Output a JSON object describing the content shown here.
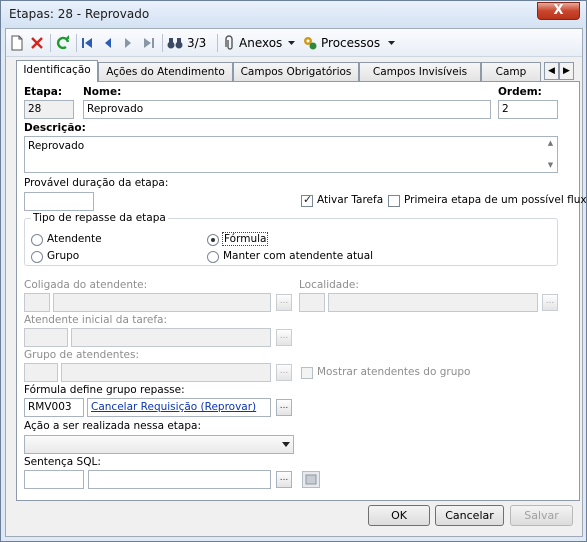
{
  "window": {
    "title": "Etapas: 28 - Reprovado",
    "close_label": "X"
  },
  "toolbar": {
    "record_counter": "3/3",
    "attachments_label": "Anexos",
    "processes_label": "Processos"
  },
  "tabs": [
    {
      "label": "Identificação"
    },
    {
      "label": "Ações do Atendimento"
    },
    {
      "label": "Campos Obrigatórios"
    },
    {
      "label": "Campos Invisíveis"
    },
    {
      "label": "Camp"
    }
  ],
  "form": {
    "etapa": {
      "label": "Etapa:",
      "value": "28"
    },
    "nome": {
      "label": "Nome:",
      "value": "Reprovado"
    },
    "ordem": {
      "label": "Ordem:",
      "value": "2"
    },
    "descricao": {
      "label": "Descrição:",
      "value": "Reprovado"
    },
    "duracao": {
      "label": "Provável duração da etapa:",
      "value": ""
    },
    "ativar_tarefa": {
      "label": "Ativar Tarefa",
      "checked": true
    },
    "primeira_etapa": {
      "label": "Primeira etapa de um possível fluxo",
      "checked": false
    },
    "repasse": {
      "label": "Tipo de repasse da etapa",
      "options": [
        {
          "label": "Atendente",
          "selected": false
        },
        {
          "label": "Grupo",
          "selected": false
        },
        {
          "label": "Fórmula",
          "selected": true
        },
        {
          "label": "Manter com atendente atual",
          "selected": false
        }
      ]
    },
    "coligada": {
      "label": "Coligada do atendente:"
    },
    "localidade": {
      "label": "Localidade:"
    },
    "atendente_inicial": {
      "label": "Atendente inicial da tarefa:"
    },
    "grupo_atendentes": {
      "label": "Grupo de atendentes:"
    },
    "mostrar_atendentes": {
      "label": "Mostrar atendentes do grupo",
      "checked": false
    },
    "formula": {
      "label": "Fórmula define grupo repasse:",
      "code": "RMV003",
      "link": "Cancelar Requisição (Reprovar)"
    },
    "acao": {
      "label": "Ação a ser realizada nessa etapa:",
      "value": ""
    },
    "sql": {
      "label": "Sentença SQL:"
    },
    "browse_label": "..."
  },
  "buttons": {
    "ok": "OK",
    "cancel": "Cancelar",
    "save": "Salvar"
  }
}
